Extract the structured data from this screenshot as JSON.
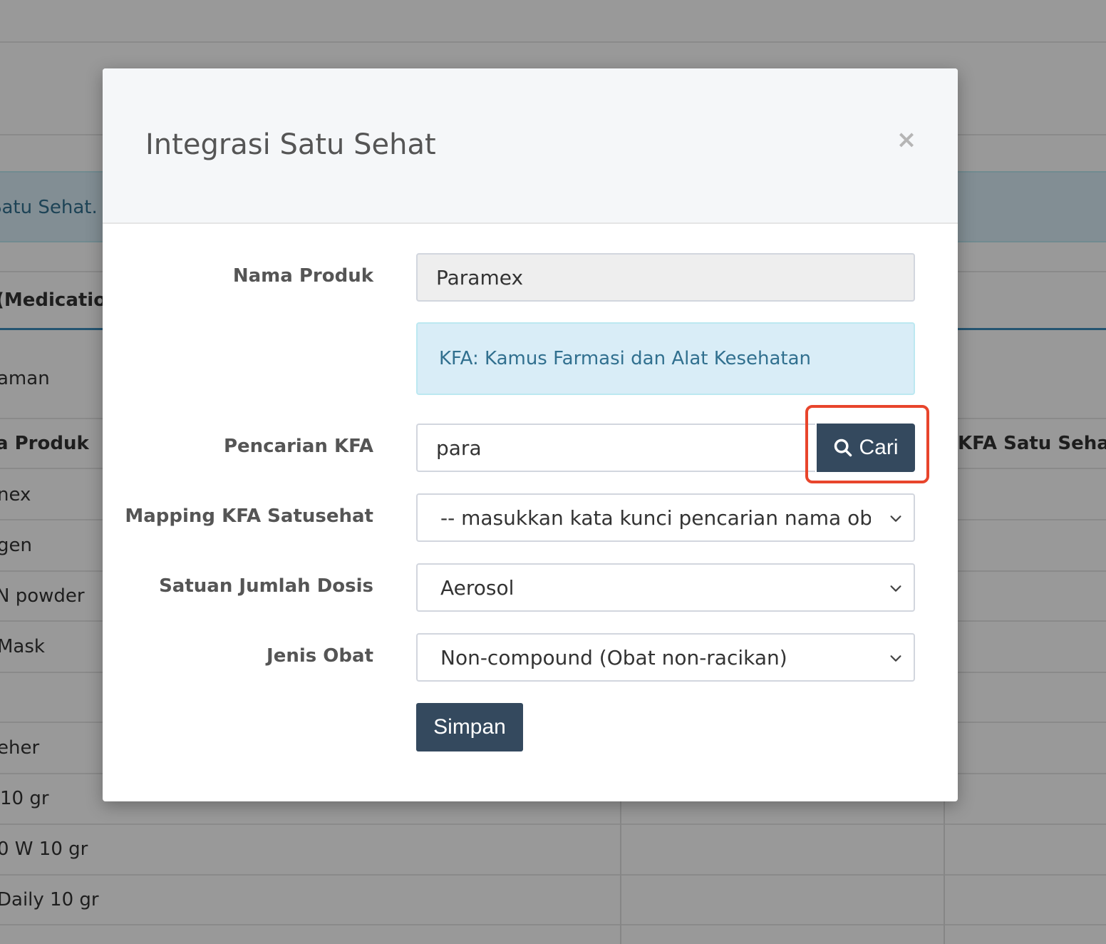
{
  "background": {
    "alert_text": "Satu Sehat.",
    "tab_text": "(Medication",
    "rows": {
      "r1": "aman",
      "header_left": "a Produk",
      "header_right": "KFA Satu Sehat",
      "r2": "nex",
      "r3": "gen",
      "r4": "N powder",
      "r5": "Mask",
      "r6": "eher",
      "r7": "10 gr",
      "r8": "0 W 10 gr",
      "r9": " Daily 10 gr"
    }
  },
  "modal": {
    "title": "Integrasi Satu Sehat",
    "close_label": "×",
    "nama_produk": {
      "label": "Nama Produk",
      "value": "Paramex"
    },
    "info": "KFA: Kamus Farmasi dan Alat Kesehatan",
    "pencarian": {
      "label": "Pencarian KFA",
      "value": "para",
      "button_label": "Cari"
    },
    "mapping": {
      "label": "Mapping KFA Satusehat",
      "selected": "-- masukkan kata kunci pencarian nama obat --"
    },
    "satuan": {
      "label": "Satuan Jumlah Dosis",
      "selected": "Aerosol"
    },
    "jenis": {
      "label": "Jenis Obat",
      "selected": "Non-compound (Obat non-racikan)"
    },
    "save_label": "Simpan"
  },
  "colors": {
    "primary_button": "#34495e",
    "info_bg": "#d9edf7",
    "info_text": "#31708f",
    "highlight": "#e8452c"
  }
}
